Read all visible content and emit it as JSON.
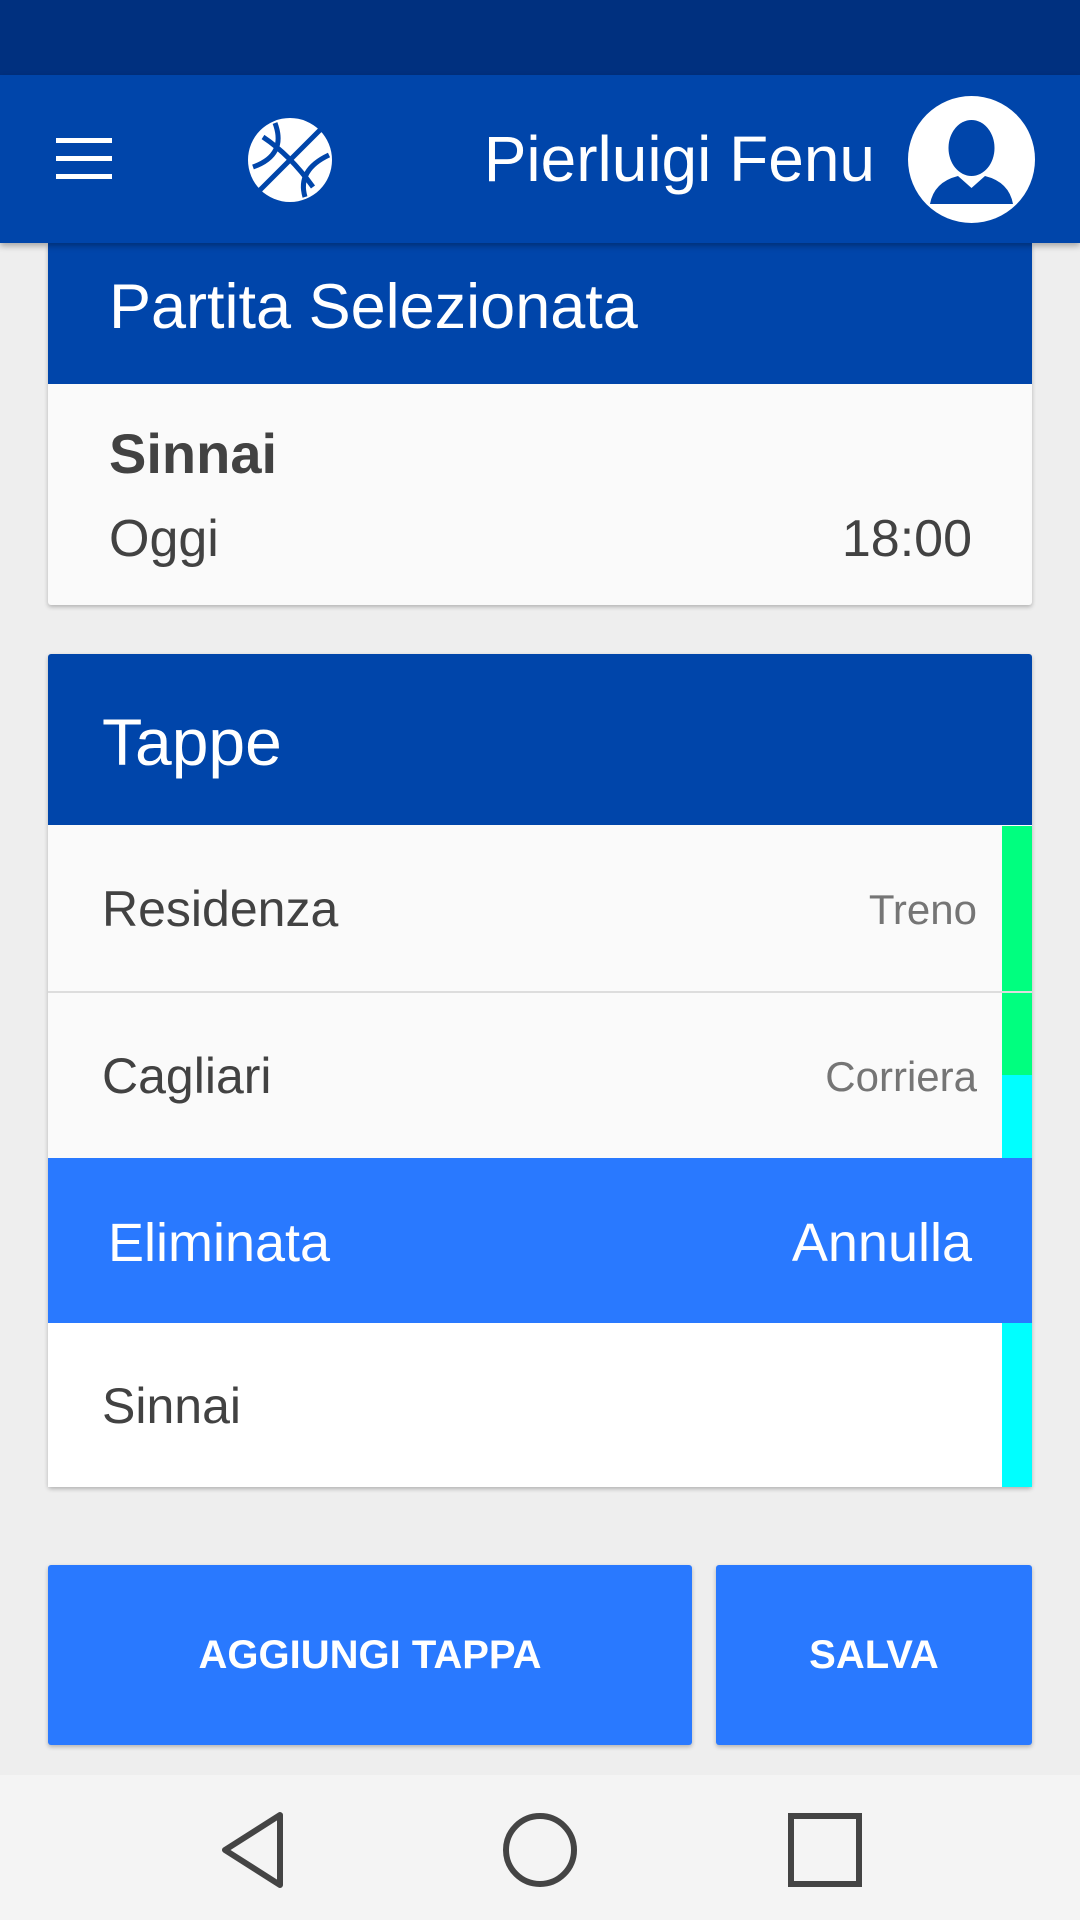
{
  "app_bar": {
    "menu_icon": "hamburger-menu-icon",
    "logo_icon": "basketball-icon",
    "user_name": "Pierluigi Fenu",
    "avatar_icon": "user-avatar-icon"
  },
  "match_card": {
    "title": "Partita Selezionata",
    "name": "Sinnai",
    "day": "Oggi",
    "time": "18:00"
  },
  "stages_card": {
    "title": "Tappe",
    "stages": [
      {
        "label": "Residenza",
        "mode": "Treno"
      },
      {
        "label": "Cagliari",
        "mode": "Corriera"
      },
      {
        "label": "Sinnai",
        "mode": ""
      }
    ],
    "deleted_row": {
      "label": "Eliminata",
      "undo": "Annulla"
    }
  },
  "buttons": {
    "add_stage": "AGGIUNGI TAPPA",
    "save": "SALVA"
  },
  "nav_bar": {
    "back_icon": "back-triangle-icon",
    "home_icon": "home-circle-icon",
    "recents_icon": "recents-square-icon"
  },
  "colors": {
    "primary": "#0045aa",
    "status_bar": "#00307f",
    "accent": "#2979ff",
    "train_strip": "#00ff7f",
    "bus_strip": "#00ffff"
  }
}
